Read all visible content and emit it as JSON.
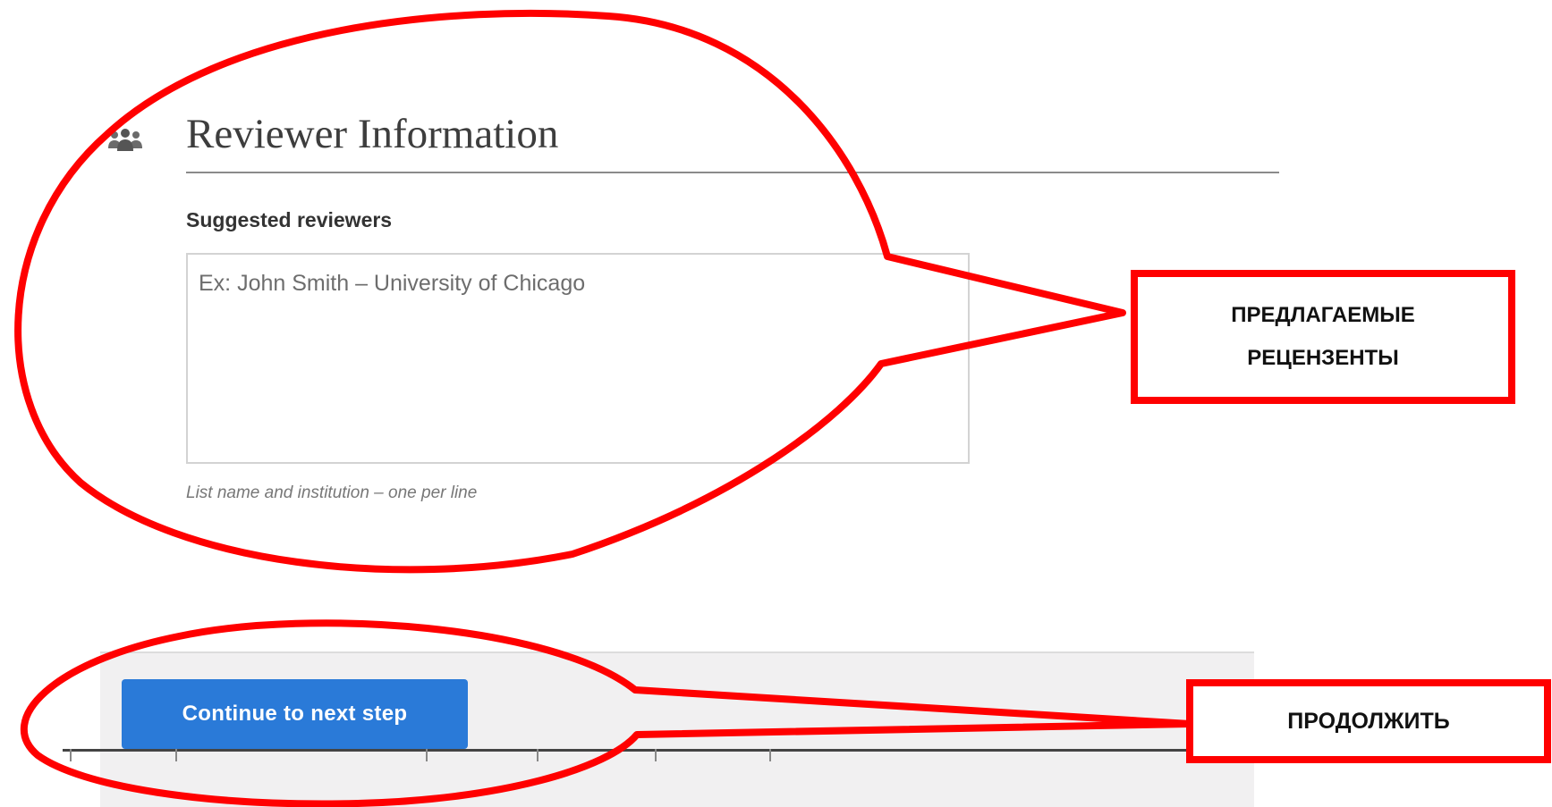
{
  "section": {
    "title": "Reviewer Information",
    "icon": "people-group-icon"
  },
  "reviewers_field": {
    "label": "Suggested reviewers",
    "value": "",
    "placeholder": "Ex: John Smith – University of Chicago",
    "help_text": "List name and institution – one per line"
  },
  "footer": {
    "continue_label": "Continue to next step"
  },
  "annotations": {
    "reviewers_callout": "ПРЕДЛАГАЕМЫЕ РЕЦЕНЗЕНТЫ",
    "continue_callout": "ПРОДОЛЖИТЬ",
    "highlight_color": "#ff0000"
  },
  "colors": {
    "button": "#2a7ad8",
    "footer_background": "#f1f0f1"
  }
}
